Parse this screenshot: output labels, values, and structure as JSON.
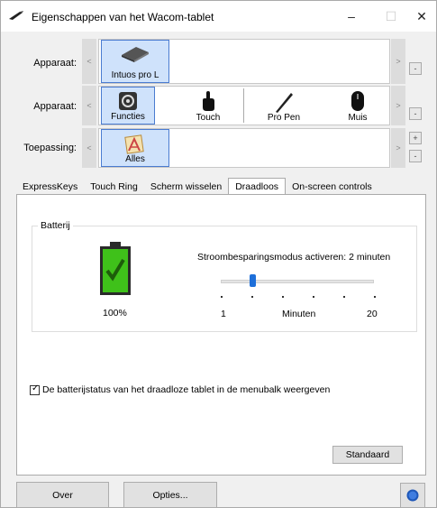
{
  "window": {
    "title": "Eigenschappen van het Wacom-tablet",
    "minimize": "–",
    "maximize": "☐",
    "close": "✕"
  },
  "rows": {
    "device": {
      "label": "Apparaat:",
      "selected": "Intuos pro L"
    },
    "tool": {
      "label": "Apparaat:",
      "items": [
        "Functies",
        "Touch",
        "Pro Pen",
        "Muis"
      ]
    },
    "application": {
      "label": "Toepassing:",
      "selected": "Alles"
    },
    "arrow_left": "<",
    "arrow_right": ">",
    "plus": "+",
    "minus": "-"
  },
  "tabs": [
    "ExpressKeys",
    "Touch Ring",
    "Scherm wisselen",
    "Draadloos",
    "On-screen controls"
  ],
  "active_tab": "Draadloos",
  "battery_group": {
    "legend": "Batterij",
    "battery_level_text": "100%",
    "battery_level": 1.0,
    "sleep_label": "Stroombesparingsmodus activeren: 2 minuten",
    "slider": {
      "min": 1,
      "max": 20,
      "value": 2,
      "unit": "Minuten",
      "min_label": "1",
      "max_label": "20"
    }
  },
  "checkbox": {
    "label": "De batterijstatus van het draadloze tablet in de menubalk weergeven",
    "checked": true,
    "mark": "✓"
  },
  "buttons": {
    "default": "Standaard",
    "about": "Over",
    "options": "Opties...",
    "help": "?"
  },
  "colors": {
    "selection": "#cfe2fb",
    "selection_border": "#4a7bd0",
    "battery_green": "#3fc11a",
    "slider_thumb": "#1e6fd9"
  }
}
